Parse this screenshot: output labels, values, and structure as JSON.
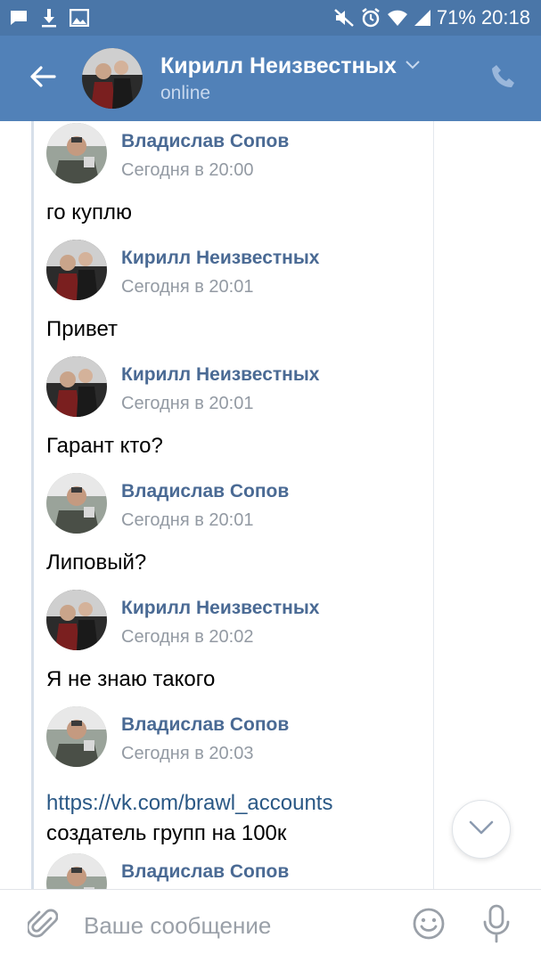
{
  "status_bar": {
    "battery": "71%",
    "time": "20:18",
    "left_icons": [
      "message-icon",
      "download-icon",
      "image-icon"
    ],
    "right_icons": [
      "mute-icon",
      "alarm-icon",
      "wifi-icon",
      "signal-icon"
    ]
  },
  "header": {
    "name": "Кирилл Неизвестных",
    "status": "online",
    "icons": [
      "back-arrow-icon",
      "chevron-down-icon",
      "phone-icon"
    ]
  },
  "messages": [
    {
      "author": "Владислав Сопов",
      "time": "Сегодня в 20:00",
      "text": "го куплю",
      "avatar": "vladislav"
    },
    {
      "author": "Кирилл Неизвестных",
      "time": "Сегодня в 20:01",
      "text": "Привет",
      "avatar": "kirill"
    },
    {
      "author": "Кирилл Неизвестных",
      "time": "Сегодня в 20:01",
      "text": "Гарант кто?",
      "avatar": "kirill"
    },
    {
      "author": "Владислав Сопов",
      "time": "Сегодня в 20:01",
      "text": "Липовый?",
      "avatar": "vladislav"
    },
    {
      "author": "Кирилл Неизвестных",
      "time": "Сегодня в 20:02",
      "text": "Я не знаю такого",
      "avatar": "kirill"
    },
    {
      "author": "Владислав Сопов",
      "time": "Сегодня в 20:03",
      "link": "https://vk.com/brawl_accounts",
      "text": "создатель групп на 100к",
      "avatar": "vladislav"
    },
    {
      "author": "Владислав Сопов",
      "time": "",
      "text": "",
      "avatar": "vladislav"
    }
  ],
  "composer": {
    "placeholder": "Ваше сообщение",
    "icons": [
      "paperclip-icon",
      "emoji-icon",
      "microphone-icon"
    ]
  },
  "colors": {
    "status_bar": "#4a76a8",
    "header": "#5181b8",
    "author": "#4a6a94",
    "link": "#2a5885"
  }
}
